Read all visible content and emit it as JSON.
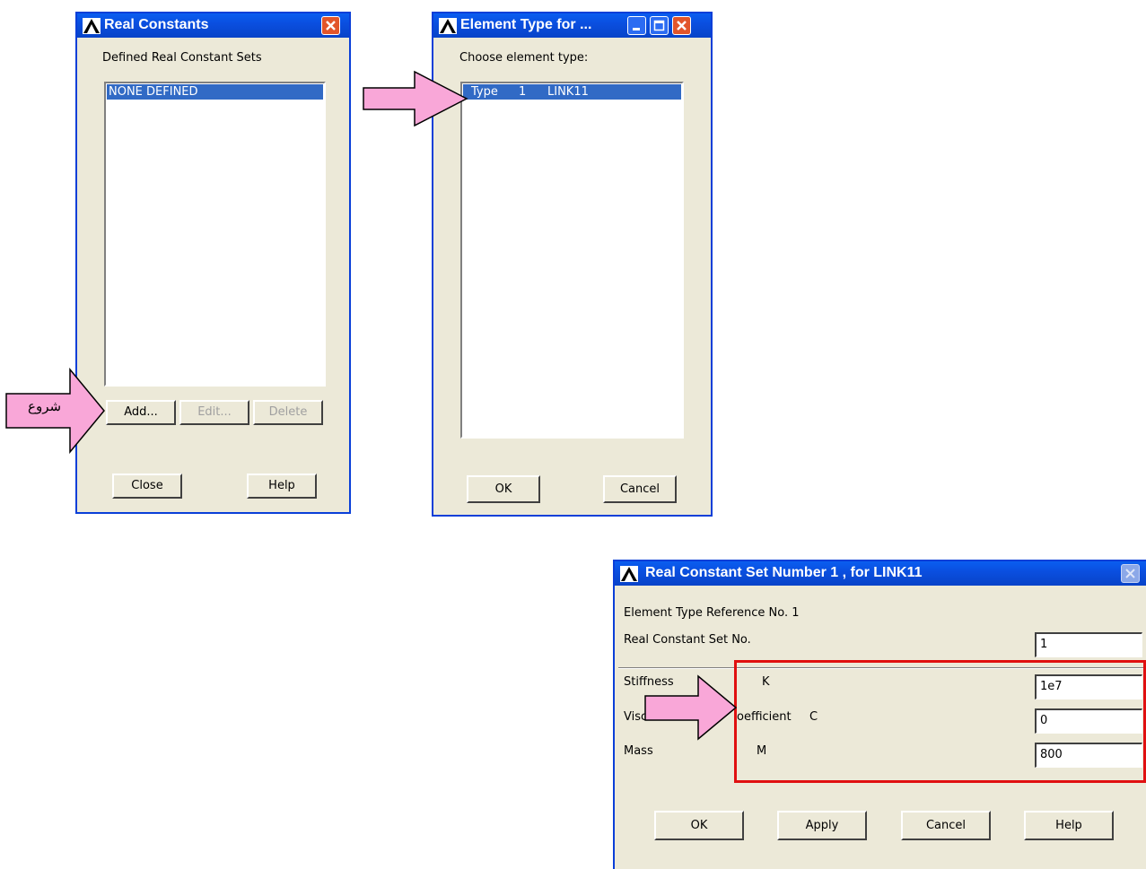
{
  "real_constants": {
    "title": "Real Constants",
    "heading": "Defined Real Constant Sets",
    "list_items": [
      "NONE DEFINED"
    ],
    "add_label": "Add...",
    "edit_label": "Edit...",
    "delete_label": "Delete",
    "close_label": "Close",
    "help_label": "Help"
  },
  "element_type": {
    "title": "Element Type for ...",
    "prompt": "Choose element type:",
    "selected": {
      "type_label": "Type",
      "number": "1",
      "element": "LINK11"
    },
    "ok_label": "OK",
    "cancel_label": "Cancel"
  },
  "set_dialog": {
    "title": "Real Constant Set Number 1 , for LINK11",
    "element_ref": "Element Type Reference No. 1",
    "set_no_label": "Real Constant Set No.",
    "set_no_value": "1",
    "rows": [
      {
        "label": "Stiffness",
        "symbol": "K",
        "value": "1e7"
      },
      {
        "label": "Viscous Coefficient",
        "label_visible_start": "Visc",
        "label_visible_end": "oefficient",
        "symbol": "C",
        "value": "0"
      },
      {
        "label": "Mass",
        "symbol": "M",
        "value": "800"
      }
    ],
    "ok_label": "OK",
    "apply_label": "Apply",
    "cancel_label": "Cancel",
    "help_label": "Help"
  },
  "annotation": {
    "start_label": "شروع",
    "arrow_color": "#f9a7d8",
    "highlight_color": "#e01010"
  },
  "colors": {
    "titlebar": "#0a4fe0",
    "selection": "#316ac5",
    "dialog_bg": "#ece9d8"
  }
}
